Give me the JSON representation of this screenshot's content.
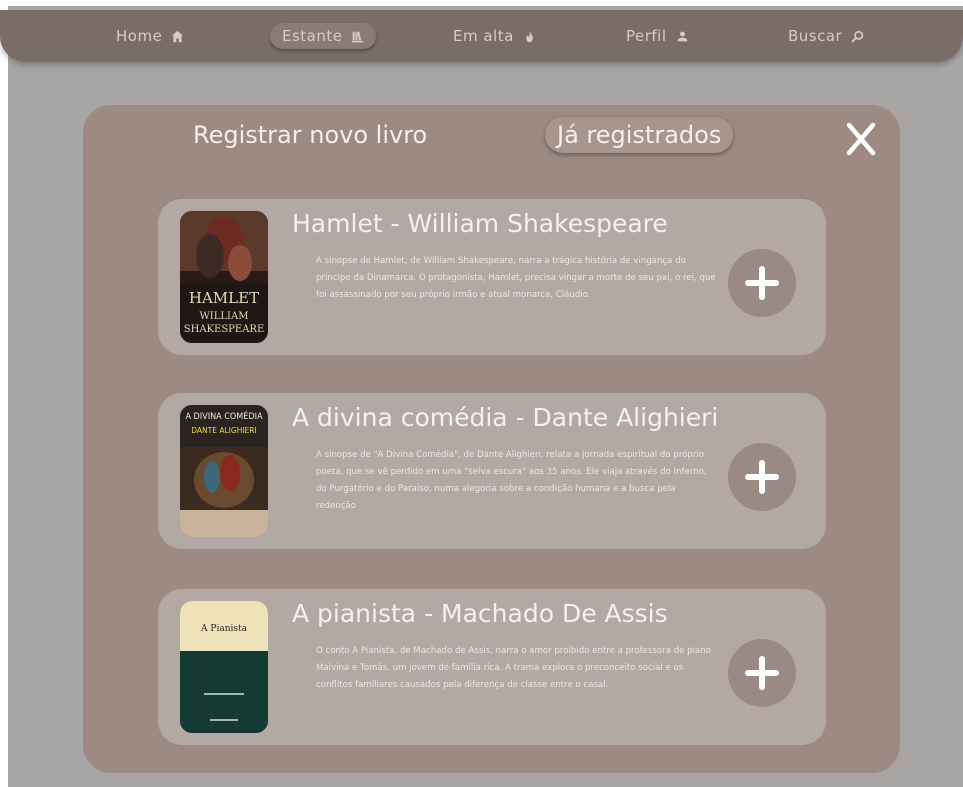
{
  "nav": {
    "items": [
      {
        "label": "Home",
        "icon": "home-icon"
      },
      {
        "label": "Estante",
        "icon": "bookshelf-icon",
        "active": true
      },
      {
        "label": "Em alta",
        "icon": "fire-icon"
      },
      {
        "label": "Perfil",
        "icon": "user-icon"
      },
      {
        "label": "Buscar",
        "icon": "search-icon"
      }
    ]
  },
  "modal": {
    "tab_register": "Registrar novo livro",
    "tab_registered": "Já registrados",
    "close_icon": "close-icon"
  },
  "books": [
    {
      "title": "Hamlet - William Shakespeare",
      "synopsis": "A sinopse de Hamlet, de William Shakespeare, narra a trágica história de vingança do príncipe da Dinamarca. O protagonista, Hamlet, precisa vingar a morte de seu pai, o rei, que foi assassinado por seu próprio irmão e atual monarca, Cláudio.",
      "cover_text": [
        "HAMLET",
        "WILLIAM",
        "SHAKESPEARE"
      ]
    },
    {
      "title": "A divina comédia - Dante Alighieri",
      "synopsis": "A sinopse de \"A Divina Comédia\", de Dante Alighieri, relata a jornada espiritual do próprio poeta, que se vê perdido em uma \"selva escura\" aos 35 anos. Ele viaja através do Inferno, do Purgatório e do Paraíso, numa alegoria sobre a condição humana e a busca pela redenção",
      "cover_text": [
        "A DIVINA COMÉDIA",
        "DANTE ALIGHIERI"
      ]
    },
    {
      "title": "A pianista - Machado De Assis",
      "synopsis": "O conto A Pianista, de Machado de Assis, narra o amor proibido entre a professora de piano Malvina e Tomás, um jovem de família rica. A trama explora o preconceito social e os conflitos familiares causados pela diferença de classe entre o casal.",
      "cover_text": [
        "A Pianista"
      ]
    }
  ],
  "colors": {
    "navbar": "#7a6c66",
    "page_background": "#a7a6a5",
    "modal": "#9c8a83",
    "card": "#b3a8a4",
    "add_button": "#9b8a84"
  }
}
